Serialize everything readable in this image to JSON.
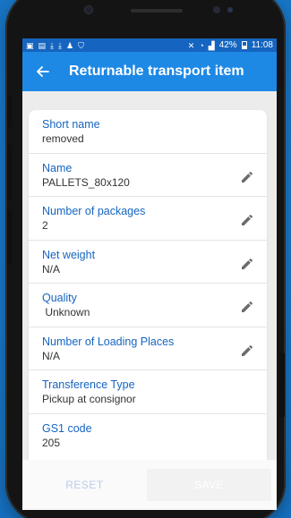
{
  "statusbar": {
    "battery": "42%",
    "time": "11:08"
  },
  "appbar": {
    "title": "Returnable transport item"
  },
  "fields": [
    {
      "label": "Short name",
      "value": "removed",
      "editable": false
    },
    {
      "label": "Name",
      "value": "PALLETS_80x120",
      "editable": true
    },
    {
      "label": "Number of packages",
      "value": "2",
      "editable": true
    },
    {
      "label": "Net weight",
      "value": "N/A",
      "editable": true
    },
    {
      "label": "Quality",
      "value": " Unknown",
      "editable": true
    },
    {
      "label": "Number of Loading Places",
      "value": "N/A",
      "editable": true
    },
    {
      "label": "Transference Type",
      "value": "Pickup at consignor",
      "editable": false
    },
    {
      "label": "GS1 code",
      "value": "205",
      "editable": false
    }
  ],
  "buttons": {
    "reset": "RESET",
    "save": "SAVE"
  },
  "colors": {
    "background": "#1e88d8",
    "appbar": "#1e88e5",
    "statusbar": "#1565c0",
    "label": "#1565c0"
  },
  "icons": [
    "back-arrow-icon",
    "pencil-edit-icon"
  ]
}
